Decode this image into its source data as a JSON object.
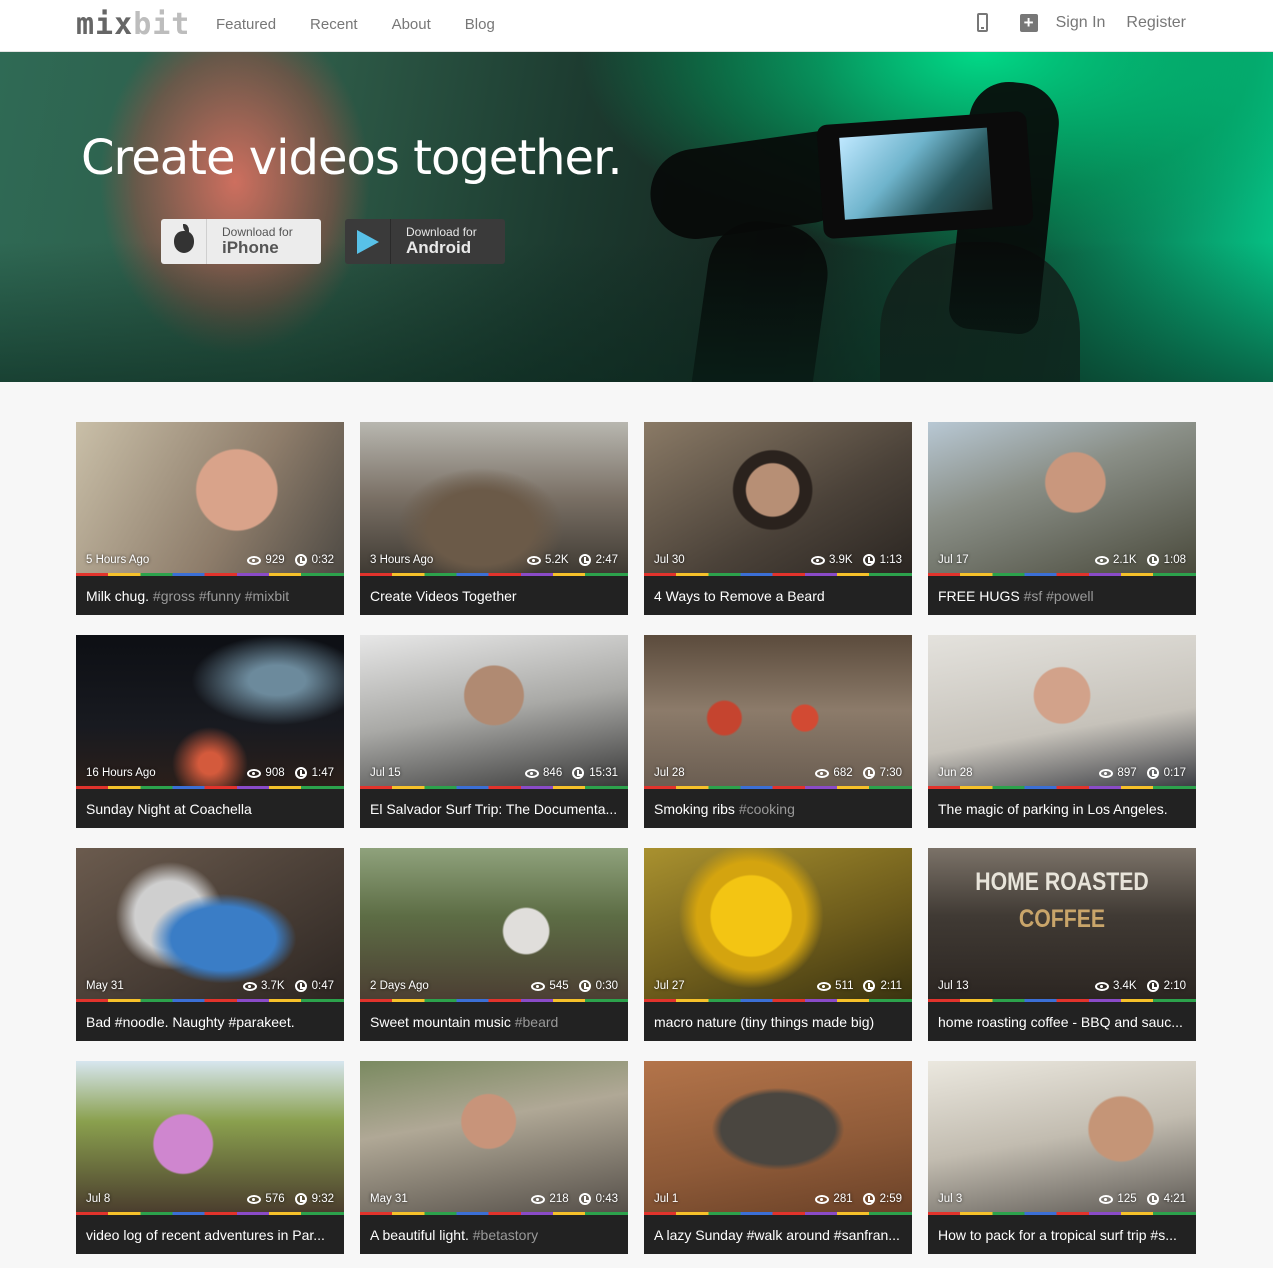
{
  "nav": {
    "logo_mix": "mix",
    "logo_bit": "bit",
    "links": [
      "Featured",
      "Recent",
      "About",
      "Blog"
    ],
    "phone_icon": "mobile-phone-icon",
    "add_icon": "plus-square-icon",
    "signin": "Sign In",
    "register": "Register"
  },
  "hero": {
    "headline": "Create videos together.",
    "ios": {
      "small": "Download for",
      "big": "iPhone",
      "icon": "apple-icon"
    },
    "android": {
      "small": "Download for",
      "big": "Android",
      "icon": "google-play-icon"
    }
  },
  "colors": {
    "card_bg": "#222222",
    "tag": "#999999",
    "hero_green": "#05c98a"
  },
  "videos": [
    {
      "date": "5 Hours Ago",
      "views": "929",
      "duration": "0:32",
      "title": "Milk chug. ",
      "tags": "#gross #funny #mixbit"
    },
    {
      "date": "3 Hours Ago",
      "views": "5.2K",
      "duration": "2:47",
      "title": "Create Videos Together",
      "tags": ""
    },
    {
      "date": "Jul 30",
      "views": "3.9K",
      "duration": "1:13",
      "title": "4 Ways to Remove a Beard",
      "tags": ""
    },
    {
      "date": "Jul 17",
      "views": "2.1K",
      "duration": "1:08",
      "title": "FREE HUGS ",
      "tags": "#sf #powell"
    },
    {
      "date": "16 Hours Ago",
      "views": "908",
      "duration": "1:47",
      "title": "Sunday Night at Coachella",
      "tags": ""
    },
    {
      "date": "Jul 15",
      "views": "846",
      "duration": "15:31",
      "title": "El Salvador Surf Trip: The Documenta...",
      "tags": ""
    },
    {
      "date": "Jul 28",
      "views": "682",
      "duration": "7:30",
      "title": "Smoking ribs ",
      "tags": "#cooking"
    },
    {
      "date": "Jun 28",
      "views": "897",
      "duration": "0:17",
      "title": "The magic of parking in Los Angeles.",
      "tags": ""
    },
    {
      "date": "May 31",
      "views": "3.7K",
      "duration": "0:47",
      "title": "Bad #noodle. Naughty #parakeet.",
      "tags": ""
    },
    {
      "date": "2 Days Ago",
      "views": "545",
      "duration": "0:30",
      "title": "Sweet mountain music ",
      "tags": "#beard"
    },
    {
      "date": "Jul 27",
      "views": "511",
      "duration": "2:11",
      "title": "macro nature (tiny things made big)",
      "tags": ""
    },
    {
      "date": "Jul 13",
      "views": "3.4K",
      "duration": "2:10",
      "title": "home roasting coffee - BBQ and sauc...",
      "tags": "",
      "thumb_text_1": "HOME ROASTED",
      "thumb_text_2": "COFFEE"
    },
    {
      "date": "Jul 8",
      "views": "576",
      "duration": "9:32",
      "title": "video log of recent adventures in Par...",
      "tags": ""
    },
    {
      "date": "May 31",
      "views": "218",
      "duration": "0:43",
      "title": "A beautiful light. ",
      "tags": "#betastory"
    },
    {
      "date": "Jul 1",
      "views": "281",
      "duration": "2:59",
      "title": "A lazy Sunday #walk around #sanfran...",
      "tags": ""
    },
    {
      "date": "Jul 3",
      "views": "125",
      "duration": "4:21",
      "title": "How to pack for a tropical surf trip #s...",
      "tags": ""
    }
  ]
}
